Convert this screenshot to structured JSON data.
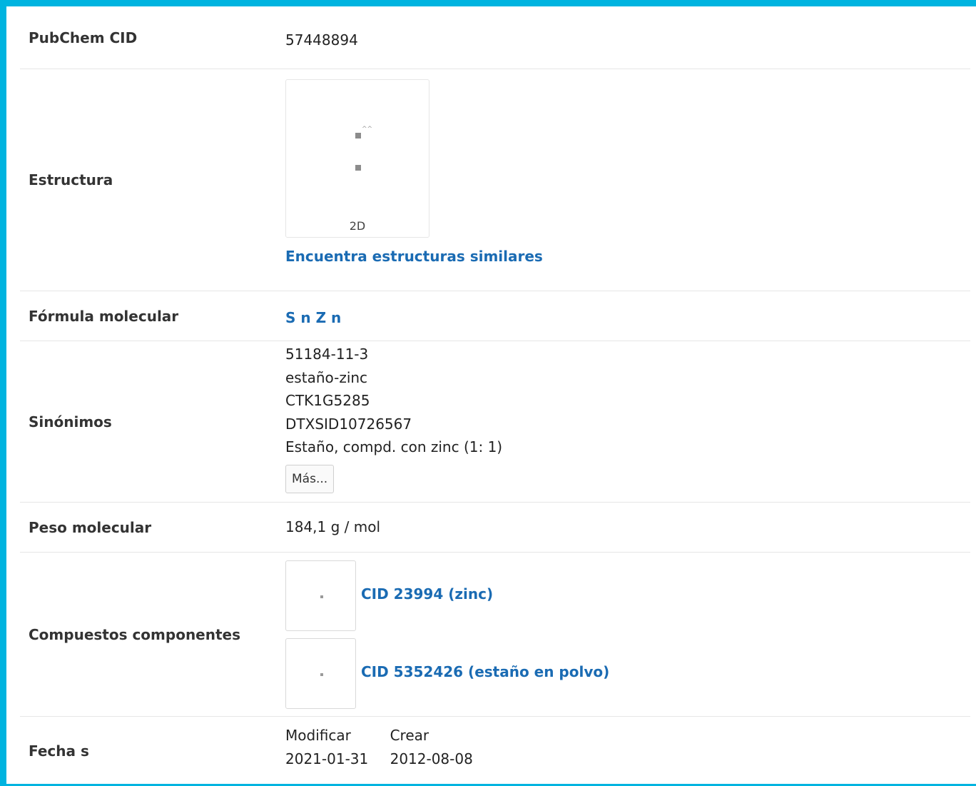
{
  "colors": {
    "accent_border": "#00b4e0",
    "link": "#1a6bb3",
    "divider": "#e6e6e6"
  },
  "rows": {
    "cid": {
      "label": "PubChem CID",
      "value": "57448894"
    },
    "structure": {
      "label": "Estructura",
      "dimension_label": "2D",
      "link_text": "Encuentra estructuras similares"
    },
    "formula": {
      "label": "Fórmula molecular",
      "value": "S n Z n"
    },
    "synonyms": {
      "label": "Sinónimos",
      "items": [
        "51184-11-3",
        "estaño-zinc",
        "CTK1G5285",
        "DTXSID10726567",
        "Estaño, compd. con zinc (1: 1)"
      ],
      "more_label": "Más..."
    },
    "weight": {
      "label": "Peso molecular",
      "value": "184,1 g / mol"
    },
    "components": {
      "label": "Compuestos componentes",
      "items": [
        {
          "link_text": "CID 23994 (zinc)"
        },
        {
          "link_text": "CID 5352426 (estaño en polvo)"
        }
      ]
    },
    "dates": {
      "label": "Fecha s",
      "modify_header": "Modificar",
      "create_header": "Crear",
      "modify_value": "2021-01-31",
      "create_value": "2012-08-08"
    }
  }
}
